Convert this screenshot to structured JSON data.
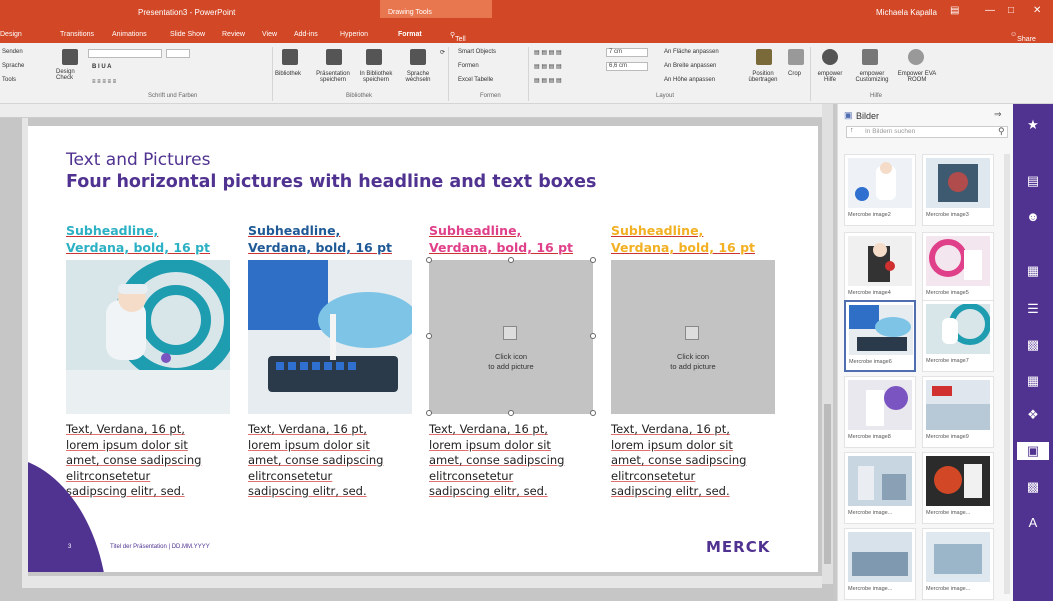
{
  "window": {
    "title": "Presentation3 - PowerPoint",
    "context_tab": "Drawing Tools",
    "user": "Michaela Kapalla",
    "share": "Share"
  },
  "tabs": [
    "Design",
    "Transitions",
    "Animations",
    "Slide Show",
    "Review",
    "View",
    "Add-ins",
    "Hyperion",
    "Format"
  ],
  "tell_me": "Tell me what you want to do",
  "ribbon": {
    "left_items": [
      "Senden",
      "Sprache",
      "Tools"
    ],
    "design_check": "Design Check",
    "font_group_label": "Schrift und Farben",
    "bibliothek_buttons": [
      "Bibliothek",
      "Präsentation speichern",
      "In Bibliothek speichern",
      "Sprache wechseln"
    ],
    "bibliothek_label": "Bibliothek",
    "formen_items": [
      "Smart Objects",
      "Formen",
      "Excel Tabelle"
    ],
    "formen_label": "Formen",
    "width_value": "7 cm",
    "height_value": "6,6 cm",
    "layout_items": [
      "An Fläche anpassen",
      "An Breite anpassen",
      "An Höhe anpassen"
    ],
    "position_btn": "Position übertragen",
    "crop_btn": "Crop",
    "layout_label": "Layout",
    "help_buttons": [
      "empower Hilfe",
      "empower Customizing",
      "Empower EVA ROOM"
    ],
    "help_label": "Hilfe"
  },
  "slide": {
    "title": "Text and Pictures",
    "subtitle": "Four horizontal pictures with headline and text boxes",
    "columns": [
      {
        "sub1": "Subheadline,",
        "sub2": "Verdana, bold, 16 pt",
        "color": "#2bb0c4",
        "picture": "lab-photo-1"
      },
      {
        "sub1": "Subheadline,",
        "sub2": "Verdana, bold, 16 pt",
        "color": "#1f5a96",
        "picture": "lab-photo-2"
      },
      {
        "sub1": "Subheadline,",
        "sub2": "Verdana, bold, 16 pt",
        "color": "#e0408a",
        "picture": "placeholder"
      },
      {
        "sub1": "Subheadline,",
        "sub2": "Verdana, bold, 16 pt",
        "color": "#f2b022",
        "picture": "placeholder"
      }
    ],
    "placeholder_text": [
      "Click icon",
      "to add picture"
    ],
    "body_lines": [
      "Text, Verdana, 16 pt,",
      "lorem ipsum dolor sit",
      "amet, conse sadipscing",
      "elitrconsetetur",
      "sadipscing elitr, sed."
    ],
    "page_num": "3",
    "footer": "Titel der Präsentation | DD.MM.YYYY",
    "logo": "MERCK"
  },
  "panel": {
    "title": "Bilder",
    "search_placeholder": "In Bildern suchen",
    "images": [
      "Mercrobe image2",
      "Mercrobe image3",
      "Mercrobe image4",
      "Mercrobe image5",
      "Mercrobe image6",
      "Mercrobe image7",
      "Mercrobe image8",
      "Mercrobe image9",
      "Mercrobe image...",
      "Mercrobe image...",
      "Mercrobe image...",
      "Mercrobe image..."
    ]
  },
  "sidebar_icons": [
    "star-icon",
    "library-icon",
    "people-icon",
    "layout-icon",
    "text-icon",
    "chart-icon",
    "table-icon",
    "puzzle-icon",
    "picture-icon",
    "slides-icon",
    "text-format-icon"
  ],
  "colors": {
    "accent": "#d24726",
    "brand": "#503291"
  }
}
